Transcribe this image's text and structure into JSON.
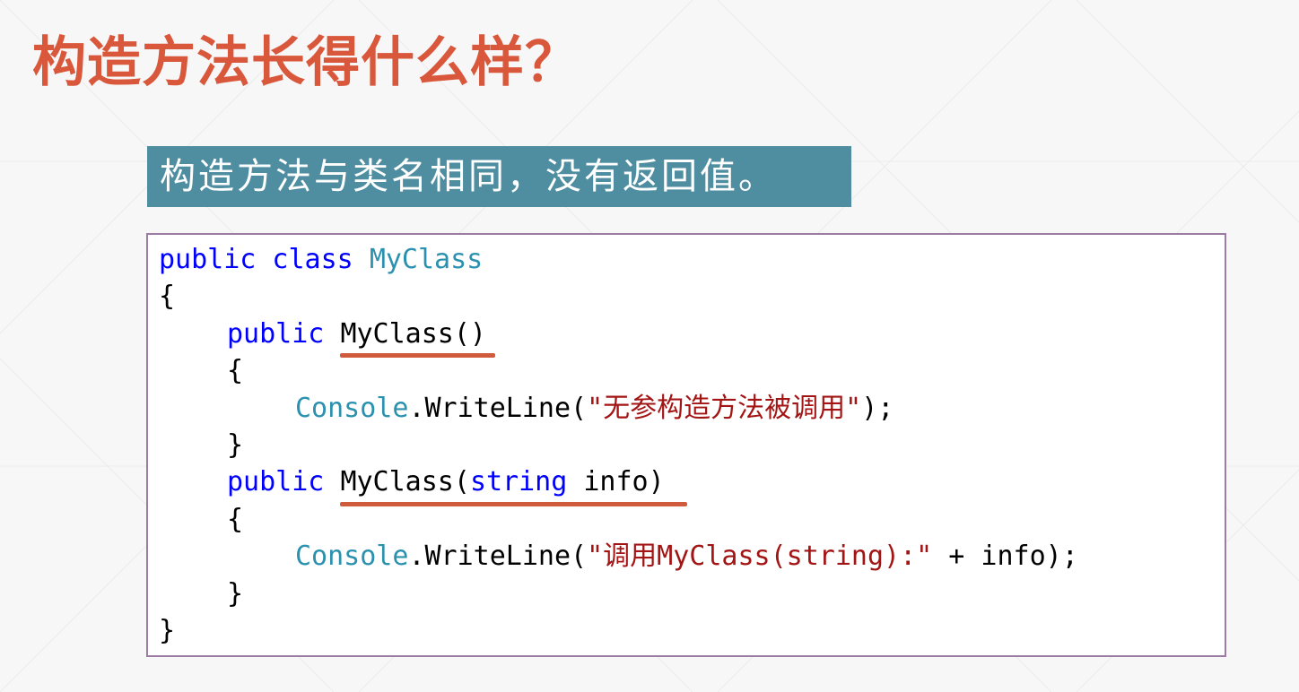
{
  "slide": {
    "title": "构造方法长得什么样？",
    "caption": "构造方法与类名相同，没有返回值。"
  },
  "colors": {
    "title": "#d9573b",
    "banner": "#4f8ea0",
    "keyword": "#0000ff",
    "type": "#2b91af",
    "string": "#a31515",
    "underline": "#cf5a3c",
    "code_border": "#9c7ca4"
  },
  "code": {
    "l1_kw": "public class ",
    "l1_type": "MyClass",
    "l2": "{",
    "l3_kw": "public ",
    "l3_sig": "MyClass()",
    "l4": "{",
    "l5_type": "Console",
    "l5_call": ".WriteLine(",
    "l5_str": "\"无参构造方法被调用\"",
    "l5_end": ");",
    "l6": "}",
    "l7_kw": "public ",
    "l7_sig_a": "MyClass(",
    "l7_kw2": "string",
    "l7_sig_b": " info)",
    "l8": "{",
    "l9_type": "Console",
    "l9_call": ".WriteLine(",
    "l9_str": "\"调用MyClass(string):\"",
    "l9_end": " + info);",
    "l10": "}",
    "l11": "}"
  }
}
